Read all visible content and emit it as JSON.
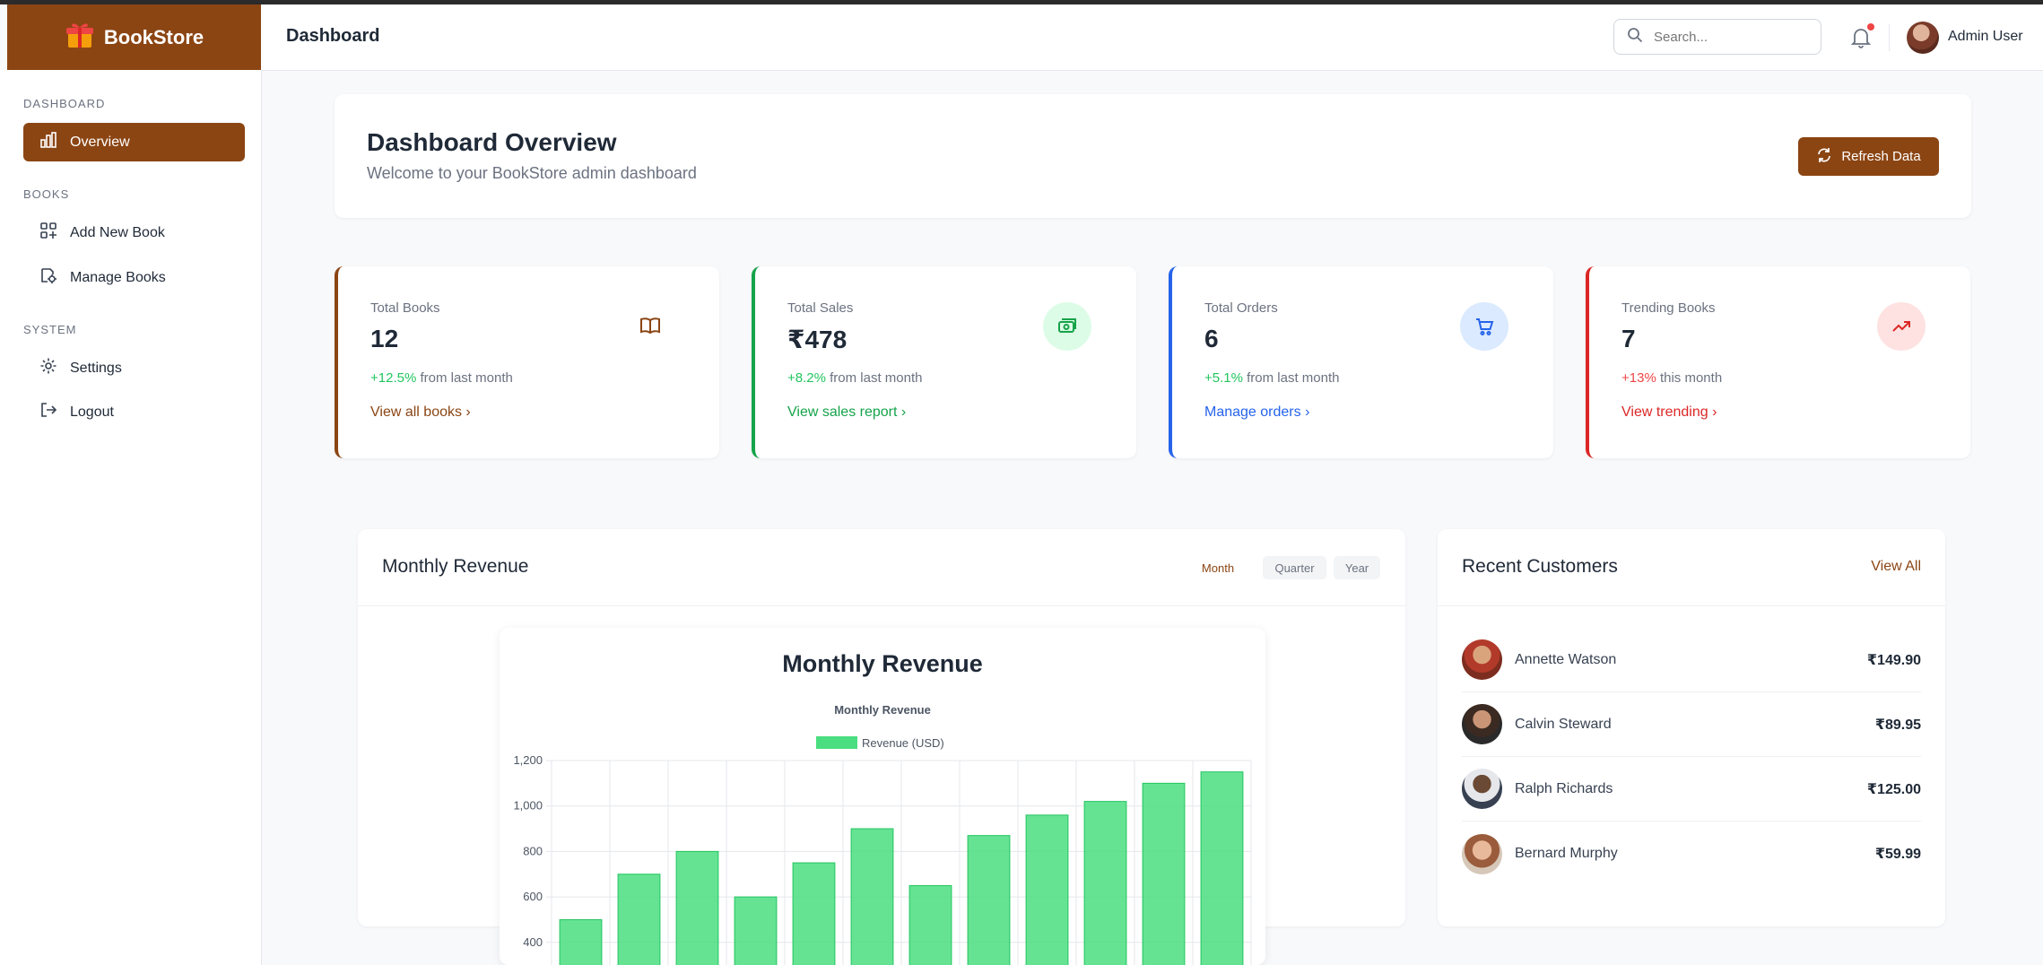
{
  "brand": {
    "name": "BookStore",
    "color": "#8b4513"
  },
  "header": {
    "title": "Dashboard",
    "search_placeholder": "Search...",
    "user_name": "Admin User"
  },
  "sidebar": {
    "sections": [
      {
        "label": "DASHBOARD",
        "items": [
          {
            "label": "Overview",
            "icon": "chart-icon",
            "active": true
          }
        ]
      },
      {
        "label": "BOOKS",
        "items": [
          {
            "label": "Add New Book",
            "icon": "grid-plus-icon"
          },
          {
            "label": "Manage Books",
            "icon": "book-gear-icon"
          }
        ]
      },
      {
        "label": "SYSTEM",
        "items": [
          {
            "label": "Settings",
            "icon": "gear-icon"
          },
          {
            "label": "Logout",
            "icon": "logout-icon"
          }
        ]
      }
    ]
  },
  "overview": {
    "title": "Dashboard Overview",
    "subtitle": "Welcome to your BookStore admin dashboard",
    "refresh_label": "Refresh Data"
  },
  "stats": [
    {
      "label": "Total Books",
      "value": "12",
      "change": "+12.5%",
      "change_text": " from last month",
      "link": "View all books",
      "accent": "#8b4513",
      "icon": "book-icon"
    },
    {
      "label": "Total Sales",
      "value": "₹478",
      "change": "+8.2%",
      "change_text": " from last month",
      "link": "View sales report",
      "accent": "#16a34a",
      "icon": "cash-icon"
    },
    {
      "label": "Total Orders",
      "value": "6",
      "change": "+5.1%",
      "change_text": " from last month",
      "link": "Manage orders",
      "accent": "#2563eb",
      "icon": "cart-icon"
    },
    {
      "label": "Trending Books",
      "value": "7",
      "change": "+13%",
      "change_text": " this month",
      "link": "View trending",
      "accent": "#dc2626",
      "icon": "trending-up-icon"
    }
  ],
  "revenue": {
    "title": "Monthly Revenue",
    "periods": [
      "Month",
      "Quarter",
      "Year"
    ],
    "active_period": "Month"
  },
  "chart_data": {
    "type": "bar",
    "title": "Monthly Revenue",
    "subtitle": "Monthly Revenue",
    "series": [
      {
        "name": "Revenue (USD)",
        "values": [
          500,
          700,
          800,
          600,
          750,
          900,
          650,
          870,
          960,
          1020,
          1100,
          1150
        ],
        "color": "#4ade80"
      }
    ],
    "ylim": [
      400,
      1200
    ],
    "yticks": [
      "1,200",
      "1,000",
      "800",
      "600",
      "400"
    ],
    "grid": true,
    "legend": "top"
  },
  "customers": {
    "title": "Recent Customers",
    "view_all": "View All",
    "list": [
      {
        "name": "Annette Watson",
        "amount": "₹149.90"
      },
      {
        "name": "Calvin Steward",
        "amount": "₹89.95"
      },
      {
        "name": "Ralph Richards",
        "amount": "₹125.00"
      },
      {
        "name": "Bernard Murphy",
        "amount": "₹59.99"
      }
    ]
  }
}
